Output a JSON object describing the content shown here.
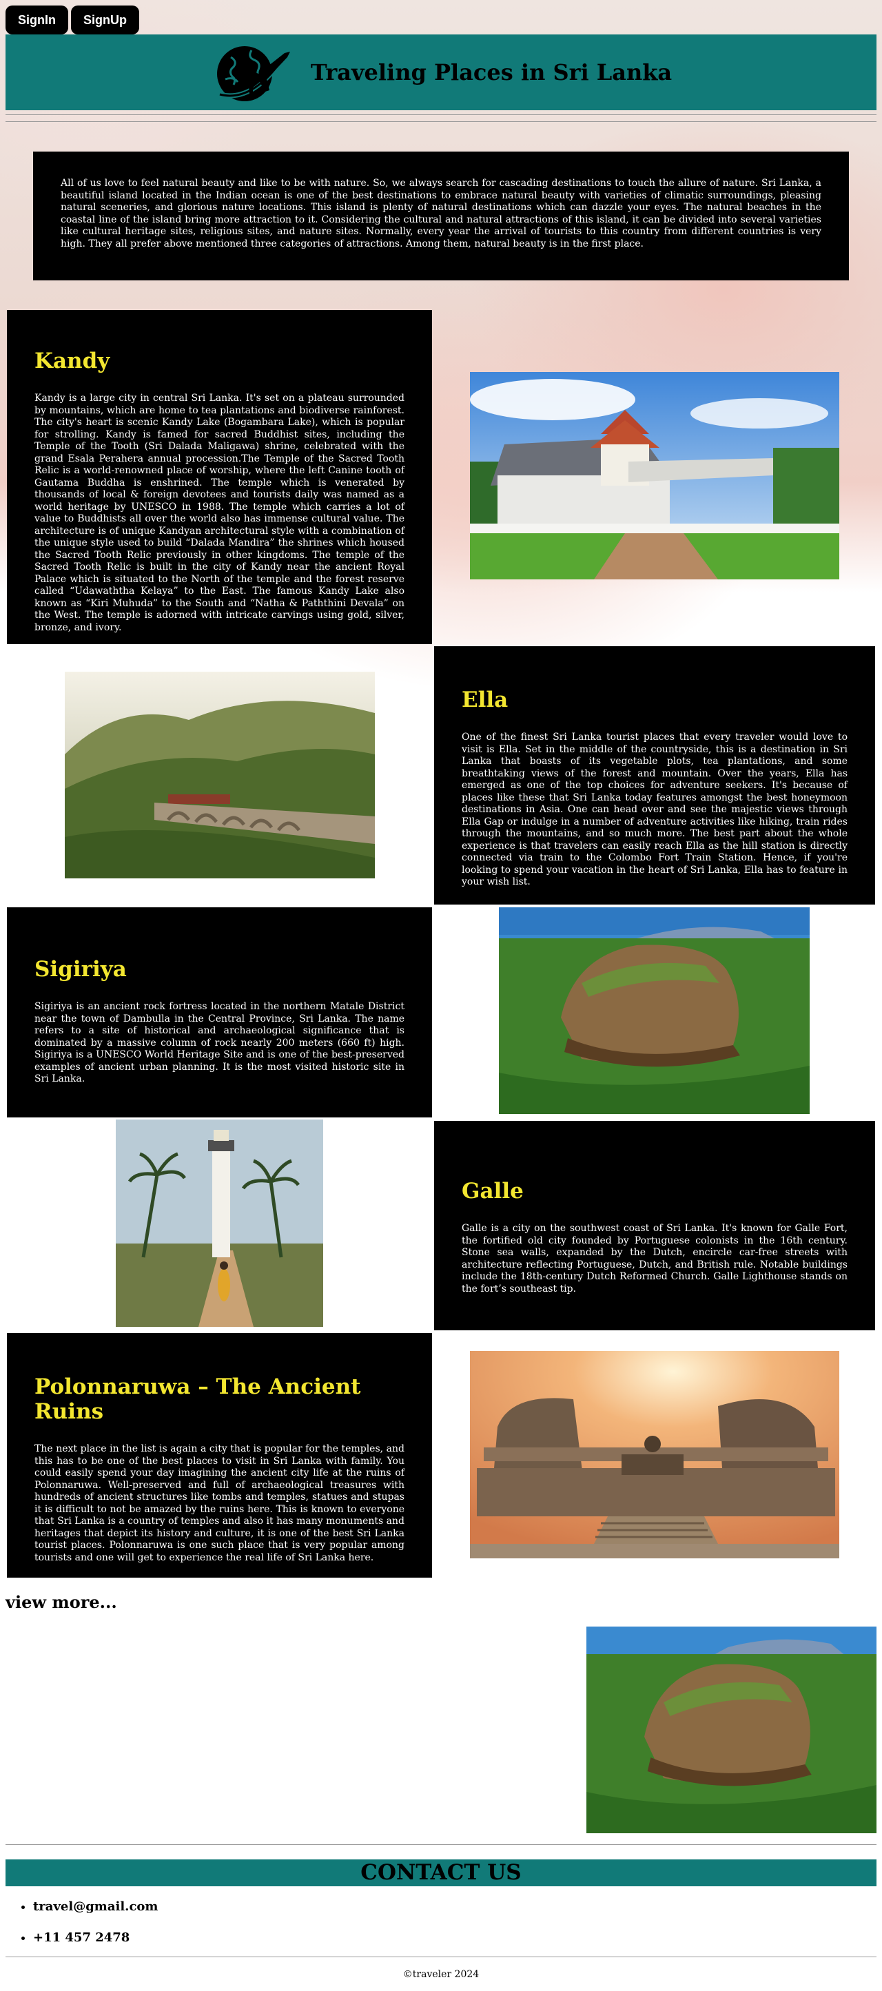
{
  "auth": {
    "signin_label": "SignIn",
    "signup_label": "SignUp"
  },
  "header": {
    "title": "Traveling Places in Sri Lanka",
    "logo_icon": "globe-airplane-icon"
  },
  "intro": {
    "text": "All of us love to feel natural beauty and like to be with nature. So, we always search for cascading destinations to touch the allure of nature. Sri Lanka, a beautiful island located in the Indian ocean is one of the best destinations to embrace natural beauty with varieties of climatic surroundings, pleasing natural sceneries, and glorious nature locations. This island is plenty of natural destinations which can dazzle your eyes. The natural beaches in the coastal line of the island bring more attraction to it. Considering the cultural and natural attractions of this island, it can be divided into several varieties like cultural heritage sites, religious sites, and nature sites. Normally, every year the arrival of tourists to this country from different countries is very high. They all prefer above mentioned three categories of attractions. Among them, natural beauty is in the first place."
  },
  "places": [
    {
      "title": "Kandy",
      "text": "Kandy is a large city in central Sri Lanka. It's set on a plateau surrounded by mountains, which are home to tea plantations and biodiverse rainforest. The city's heart is scenic Kandy Lake (Bogambara Lake), which is popular for strolling. Kandy is famed for sacred Buddhist sites, including the Temple of the Tooth (Sri Dalada Maligawa) shrine, celebrated with the grand Esala Perahera annual procession.The Temple of the Sacred Tooth Relic is a world-renowned place of worship, where the left Canine tooth of Gautama Buddha is enshrined. The temple which is venerated by thousands of local & foreign devotees and tourists daily was named as a world heritage by UNESCO in 1988. The temple which carries a lot of value to Buddhists all over the world also has immense cultural value. The architecture is of unique Kandyan architectural style with a combination of the unique style used to build “Dalada Mandira” the shrines which housed the Sacred Tooth Relic previously in other kingdoms. The temple of the Sacred Tooth Relic is built in the city of Kandy near the ancient Royal Palace which is situated to the North of the temple and the forest reserve called “Udawaththa Kelaya” to the East. The famous Kandy Lake also known as “Kiri Muhuda” to the South and “Natha & Paththini Devala” on the West. The temple is adorned with intricate carvings using gold, silver, bronze, and ivory."
    },
    {
      "title": "Ella",
      "text": "One of the finest Sri Lanka tourist places that every traveler would love to visit is Ella. Set in the middle of the countryside, this is a destination in Sri Lanka that boasts of its vegetable plots, tea plantations, and some breathtaking views of the forest and mountain. Over the years, Ella has emerged as one of the top choices for adventure seekers. It's because of places like these that Sri Lanka today features amongst the best honeymoon destinations in Asia. One can head over and see the majestic views through Ella Gap or indulge in a number of adventure activities like hiking, train rides through the mountains, and so much more. The best part about the whole experience is that travelers can easily reach Ella as the hill station is directly connected via train to the Colombo Fort Train Station. Hence, if you're looking to spend your vacation in the heart of Sri Lanka, Ella has to feature in your wish list."
    },
    {
      "title": "Sigiriya",
      "text": "Sigiriya is an ancient rock fortress located in the northern Matale District near the town of Dambulla in the Central Province, Sri Lanka. The name refers to a site of historical and archaeological significance that is dominated by a massive column of rock nearly 200 meters (660 ft) high. Sigiriya is a UNESCO World Heritage Site and is one of the best-preserved examples of ancient urban planning. It is the most visited historic site in Sri Lanka."
    },
    {
      "title": "Galle",
      "text": "Galle is a city on the southwest coast of Sri Lanka. It's known for Galle Fort, the fortified old city founded by Portuguese colonists in the 16th century. Stone sea walls, expanded by the Dutch, encircle car-free streets with architecture reflecting Portuguese, Dutch, and British rule. Notable buildings include the 18th-century Dutch Reformed Church. Galle Lighthouse stands on the fort’s southeast tip."
    },
    {
      "title": "Polonnaruwa – The Ancient Ruins",
      "text": "The next place in the list is again a city that is popular for the temples, and this has to be one of the best places to visit in Sri Lanka with family. You could easily spend your day imagining the ancient city life at the ruins of Polonnaruwa. Well-preserved and full of archaeological treasures with hundreds of ancient structures like tombs and temples, statues and stupas it is difficult to not be amazed by the ruins here. This is known to everyone that Sri Lanka is a country of temples and also it has many monuments and heritages that depict its history and culture, it is one of the best Sri Lanka tourist places. Polonnaruwa is one such place that is very popular among tourists and one will get to experience the real life of Sri Lanka here."
    }
  ],
  "view_more_label": "view more...",
  "contact": {
    "title": "CONTACT US",
    "email": "travel@gmail.com",
    "phone": "+11 457 2478"
  },
  "footer": {
    "copyright": "©traveler 2024"
  }
}
